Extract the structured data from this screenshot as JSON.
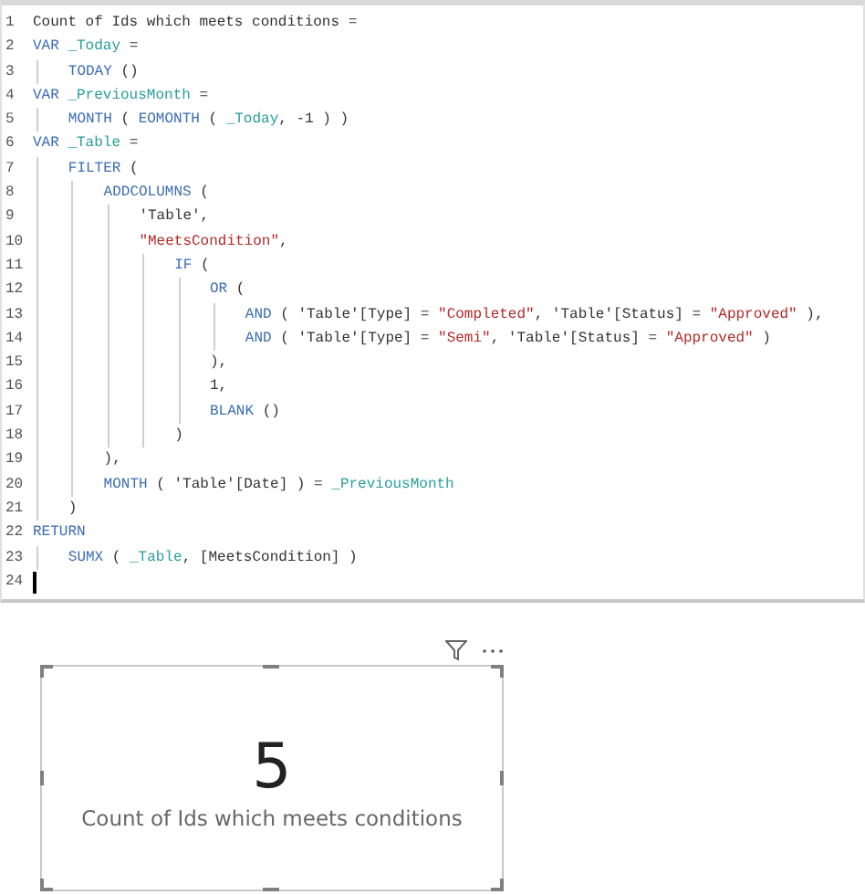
{
  "editor": {
    "lines": [
      {
        "number": "1",
        "tokens": [
          {
            "kind": "text",
            "text": "Count of Ids which meets conditions ="
          }
        ]
      },
      {
        "number": "2",
        "tokens": [
          {
            "kind": "kw",
            "text": "VAR "
          },
          {
            "kind": "var",
            "text": "_Today"
          },
          {
            "kind": "text",
            "text": " ="
          }
        ],
        "children": [
          {
            "number": "3",
            "tokens": [
              {
                "kind": "kw",
                "text": "TODAY"
              },
              {
                "kind": "text",
                "text": " ()"
              }
            ]
          }
        ]
      },
      {
        "number": "4",
        "tokens": [
          {
            "kind": "kw",
            "text": "VAR "
          },
          {
            "kind": "var",
            "text": "_PreviousMonth"
          },
          {
            "kind": "text",
            "text": " ="
          }
        ],
        "children": [
          {
            "number": "5",
            "tokens": [
              {
                "kind": "kw",
                "text": "MONTH"
              },
              {
                "kind": "text",
                "text": " ( "
              },
              {
                "kind": "kw",
                "text": "EOMONTH"
              },
              {
                "kind": "text",
                "text": " ( "
              },
              {
                "kind": "var",
                "text": "_Today"
              },
              {
                "kind": "text",
                "text": ", -1 ) )"
              }
            ]
          }
        ]
      },
      {
        "number": "6",
        "tokens": [
          {
            "kind": "kw",
            "text": "VAR "
          },
          {
            "kind": "var",
            "text": "_Table"
          },
          {
            "kind": "text",
            "text": " ="
          }
        ],
        "children": [
          {
            "number": "7",
            "tokens": [
              {
                "kind": "kw",
                "text": "FILTER"
              },
              {
                "kind": "text",
                "text": " ("
              }
            ],
            "children": [
              {
                "number": "8",
                "tokens": [
                  {
                    "kind": "kw",
                    "text": "ADDCOLUMNS"
                  },
                  {
                    "kind": "text",
                    "text": " ("
                  }
                ],
                "children": [
                  {
                    "number": "9",
                    "tokens": [
                      {
                        "kind": "text",
                        "text": "'Table',"
                      }
                    ]
                  },
                  {
                    "number": "10",
                    "tokens": [
                      {
                        "kind": "str",
                        "text": "\"MeetsCondition\""
                      },
                      {
                        "kind": "text",
                        "text": ","
                      }
                    ],
                    "children": [
                      {
                        "number": "11",
                        "tokens": [
                          {
                            "kind": "kw",
                            "text": "IF"
                          },
                          {
                            "kind": "text",
                            "text": " ("
                          }
                        ],
                        "children": [
                          {
                            "number": "12",
                            "tokens": [
                              {
                                "kind": "kw",
                                "text": "OR"
                              },
                              {
                                "kind": "text",
                                "text": " ("
                              }
                            ],
                            "children": [
                              {
                                "number": "13",
                                "tokens": [
                                  {
                                    "kind": "kw",
                                    "text": "AND"
                                  },
                                  {
                                    "kind": "text",
                                    "text": " ( 'Table'[Type] = "
                                  },
                                  {
                                    "kind": "str",
                                    "text": "\"Completed\""
                                  },
                                  {
                                    "kind": "text",
                                    "text": ", 'Table'[Status] = "
                                  },
                                  {
                                    "kind": "str",
                                    "text": "\"Approved\""
                                  },
                                  {
                                    "kind": "text",
                                    "text": " ),"
                                  }
                                ]
                              },
                              {
                                "number": "14",
                                "tokens": [
                                  {
                                    "kind": "kw",
                                    "text": "AND"
                                  },
                                  {
                                    "kind": "text",
                                    "text": " ( 'Table'[Type] = "
                                  },
                                  {
                                    "kind": "str",
                                    "text": "\"Semi\""
                                  },
                                  {
                                    "kind": "text",
                                    "text": ", 'Table'[Status] = "
                                  },
                                  {
                                    "kind": "str",
                                    "text": "\"Approved\""
                                  },
                                  {
                                    "kind": "text",
                                    "text": " )"
                                  }
                                ]
                              }
                            ]
                          },
                          {
                            "number": "15",
                            "tokens": [
                              {
                                "kind": "text",
                                "text": "),"
                              }
                            ]
                          },
                          {
                            "number": "16",
                            "tokens": [
                              {
                                "kind": "text",
                                "text": "1,"
                              }
                            ]
                          },
                          {
                            "number": "17",
                            "tokens": [
                              {
                                "kind": "kw",
                                "text": "BLANK"
                              },
                              {
                                "kind": "text",
                                "text": " ()"
                              }
                            ]
                          }
                        ]
                      },
                      {
                        "number": "18",
                        "tokens": [
                          {
                            "kind": "text",
                            "text": ")"
                          }
                        ]
                      }
                    ]
                  }
                ]
              },
              {
                "number": "19",
                "tokens": [
                  {
                    "kind": "text",
                    "text": "),"
                  }
                ]
              },
              {
                "number": "20",
                "tokens": [
                  {
                    "kind": "kw",
                    "text": "MONTH"
                  },
                  {
                    "kind": "text",
                    "text": " ( 'Table'[Date] ) = "
                  },
                  {
                    "kind": "var",
                    "text": "_PreviousMonth"
                  }
                ]
              }
            ]
          },
          {
            "number": "21",
            "tokens": [
              {
                "kind": "text",
                "text": ")"
              }
            ]
          }
        ]
      },
      {
        "number": "22",
        "tokens": [
          {
            "kind": "kw",
            "text": "RETURN"
          }
        ],
        "children": [
          {
            "number": "23",
            "tokens": [
              {
                "kind": "kw",
                "text": "SUMX"
              },
              {
                "kind": "text",
                "text": " ( "
              },
              {
                "kind": "var",
                "text": "_Table"
              },
              {
                "kind": "text",
                "text": ", [MeetsCondition] )"
              }
            ]
          }
        ]
      },
      {
        "number": "24",
        "cursor": true
      }
    ]
  },
  "card": {
    "value": "5",
    "label": "Count of Ids which meets conditions"
  }
}
